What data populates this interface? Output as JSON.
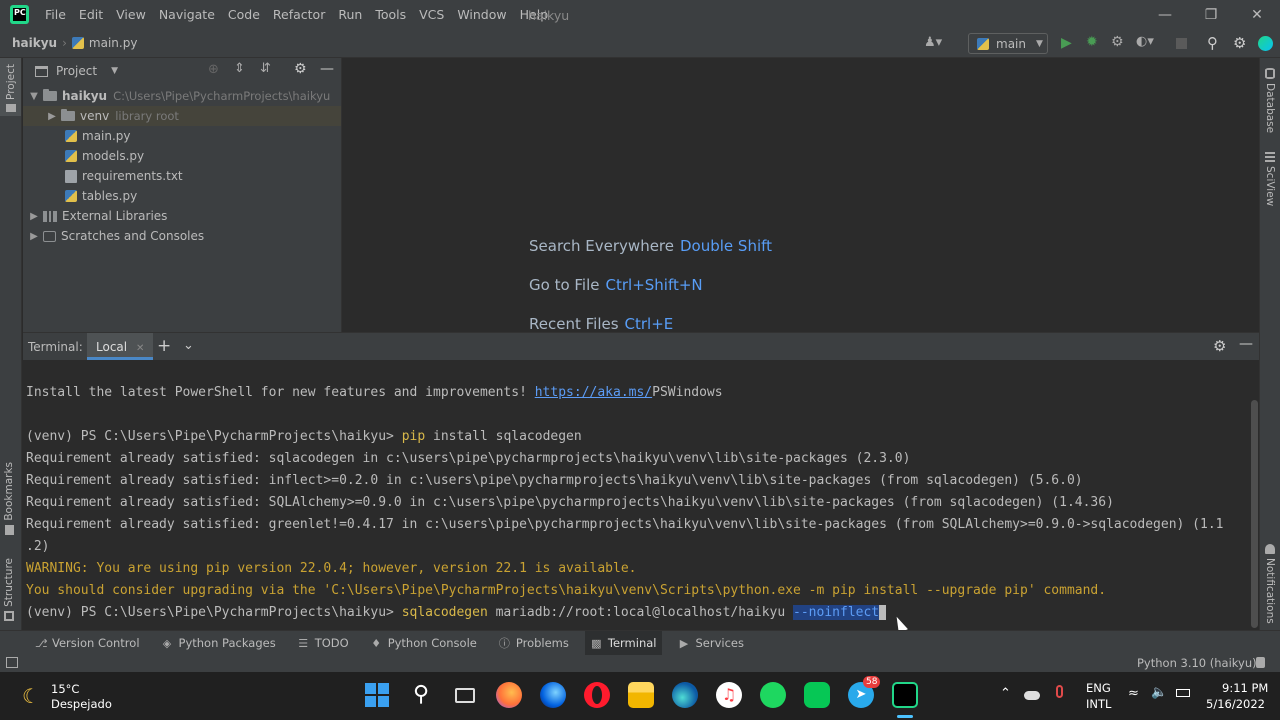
{
  "titlebar": {
    "menu": [
      "File",
      "Edit",
      "View",
      "Navigate",
      "Code",
      "Refactor",
      "Run",
      "Tools",
      "VCS",
      "Window",
      "Help"
    ],
    "project_title": "haikyu"
  },
  "navbar": {
    "breadcrumb_project": "haikyu",
    "breadcrumb_file": "main.py",
    "run_config": "main"
  },
  "project_panel": {
    "title": "Project",
    "tree": [
      {
        "label": "haikyu",
        "hint": "C:\\Users\\Pipe\\PycharmProjects\\haikyu",
        "type": "folder",
        "level": 0,
        "expanded": true
      },
      {
        "label": "venv",
        "hint": "library root",
        "type": "folder",
        "level": 1,
        "expanded": false
      },
      {
        "label": "main.py",
        "hint": "",
        "type": "py",
        "level": 1
      },
      {
        "label": "models.py",
        "hint": "",
        "type": "py",
        "level": 1
      },
      {
        "label": "requirements.txt",
        "hint": "",
        "type": "txt",
        "level": 1
      },
      {
        "label": "tables.py",
        "hint": "",
        "type": "py",
        "level": 1
      },
      {
        "label": "External Libraries",
        "hint": "",
        "type": "lib",
        "level": 0,
        "expanded": false
      },
      {
        "label": "Scratches and Consoles",
        "hint": "",
        "type": "scratch",
        "level": 0,
        "expanded": false
      }
    ]
  },
  "editor_hints": [
    {
      "text": "Search Everywhere",
      "key": "Double Shift"
    },
    {
      "text": "Go to File",
      "key": "Ctrl+Shift+N"
    },
    {
      "text": "Recent Files",
      "key": "Ctrl+E"
    }
  ],
  "left_stripe": {
    "project": "Project",
    "bookmarks": "Bookmarks",
    "structure": "Structure"
  },
  "right_stripe": {
    "database": "Database",
    "sciview": "SciView",
    "notifications": "Notifications"
  },
  "terminal": {
    "label": "Terminal:",
    "tab": "Local",
    "lines": {
      "l1_pre": "Install the latest PowerShell for new features and improvements! ",
      "l1_link": "https://aka.ms/",
      "l1_post": "PSWindows",
      "l2_prompt": "(venv) PS C:\\Users\\Pipe\\PycharmProjects\\haikyu> ",
      "l2_cmd": "pip",
      "l2_args": " install sqlacodegen",
      "l3": "Requirement already satisfied: sqlacodegen in c:\\users\\pipe\\pycharmprojects\\haikyu\\venv\\lib\\site-packages (2.3.0)",
      "l4": "Requirement already satisfied: inflect>=0.2.0 in c:\\users\\pipe\\pycharmprojects\\haikyu\\venv\\lib\\site-packages (from sqlacodegen) (5.6.0)",
      "l5": "Requirement already satisfied: SQLAlchemy>=0.9.0 in c:\\users\\pipe\\pycharmprojects\\haikyu\\venv\\lib\\site-packages (from sqlacodegen) (1.4.36)",
      "l6": "Requirement already satisfied: greenlet!=0.4.17 in c:\\users\\pipe\\pycharmprojects\\haikyu\\venv\\lib\\site-packages (from SQLAlchemy>=0.9.0->sqlacodegen) (1.1",
      "l7": ".2)",
      "l8": "WARNING: You are using pip version 22.0.4; however, version 22.1 is available.",
      "l9": "You should consider upgrading via the 'C:\\Users\\Pipe\\PycharmProjects\\haikyu\\venv\\Scripts\\python.exe -m pip install --upgrade pip' command.",
      "l10_prompt": "(venv) PS C:\\Users\\Pipe\\PycharmProjects\\haikyu> ",
      "l10_cmd": "sqlacodegen",
      "l10_args": " mariadb://root:local@localhost/haikyu ",
      "l10_sel": "--noinflect"
    }
  },
  "tool_windows": [
    "Version Control",
    "Python Packages",
    "TODO",
    "Python Console",
    "Problems",
    "Terminal",
    "Services"
  ],
  "status": {
    "interpreter": "Python 3.10 (haikyu)"
  },
  "taskbar": {
    "weather_temp": "15°C",
    "weather_desc": "Despejado",
    "telegram_badge": "58",
    "lang_top": "ENG",
    "lang_bottom": "INTL",
    "time": "9:11 PM",
    "date": "5/16/2022"
  }
}
